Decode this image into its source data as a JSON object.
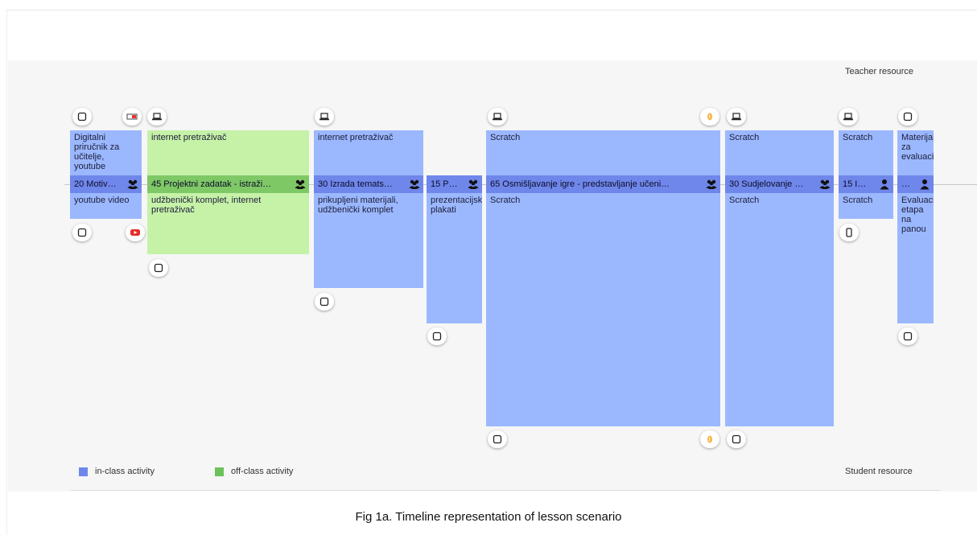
{
  "colors": {
    "in_class": "#6f87ea",
    "off_class": "#7fc866",
    "box_blue": "#9bb8ff",
    "box_green": "#c6f2a8"
  },
  "labels": {
    "teacher_resource": "Teacher resource",
    "student_resource": "Student resource",
    "legend_in_class": "in-class activity",
    "legend_off_class": "off-class activity",
    "caption": "Fig 1a. Timeline representation of lesson scenario"
  },
  "activities": [
    {
      "teacher_text": "Digitalni priručnik za učitelje, youtube",
      "bar_label": "20 Motiv…",
      "student_text": "youtube video",
      "type": "in-class",
      "group": "group",
      "teacher_icons": [
        "tablet-icon",
        "video-icon"
      ],
      "student_icons": [
        "tablet-icon",
        "youtube-icon"
      ]
    },
    {
      "teacher_text": "internet pretraživač",
      "bar_label": "45 Projektni zadatak - istraži…",
      "student_text": "udžbenički komplet, internet pretraživač",
      "type": "off-class",
      "group": "group",
      "teacher_icons": [
        "laptop-icon"
      ],
      "student_icons": [
        "tablet-icon"
      ]
    },
    {
      "teacher_text": "internet pretraživač",
      "bar_label": "30 Izrada temats…",
      "student_text": "prikupljeni materijali, udžbenički komplet",
      "type": "in-class",
      "group": "group",
      "teacher_icons": [
        "laptop-icon"
      ],
      "student_icons": [
        "tablet-icon"
      ]
    },
    {
      "teacher_text": "",
      "bar_label": "15 P…",
      "student_text": "prezentacijski plakati",
      "type": "in-class",
      "group": "group",
      "teacher_icons": [],
      "student_icons": [
        "tablet-icon"
      ]
    },
    {
      "teacher_text": "Scratch",
      "bar_label": "65 Osmišljavanje igre - predstavljanje učeni…",
      "student_text": "Scratch",
      "type": "in-class",
      "group": "group",
      "teacher_icons": [
        "laptop-icon",
        "scratch-icon"
      ],
      "student_icons": [
        "tablet-icon",
        "scratch-icon"
      ]
    },
    {
      "teacher_text": "Scratch",
      "bar_label": "30 Sudjelovanje …",
      "student_text": "Scratch",
      "type": "in-class",
      "group": "group",
      "teacher_icons": [
        "laptop-icon"
      ],
      "student_icons": [
        "tablet-icon"
      ]
    },
    {
      "teacher_text": "Scratch",
      "bar_label": "15 I…",
      "student_text": "Scratch",
      "type": "in-class",
      "group": "single",
      "teacher_icons": [
        "laptop-icon"
      ],
      "student_icons": [
        "phone-icon"
      ]
    },
    {
      "teacher_text": "Materijal za evaluaciju",
      "bar_label": "…",
      "student_text": "Evaluacija etapa na panou",
      "type": "in-class",
      "group": "single",
      "teacher_icons": [
        "tablet-icon"
      ],
      "student_icons": [
        "tablet-icon"
      ]
    }
  ]
}
